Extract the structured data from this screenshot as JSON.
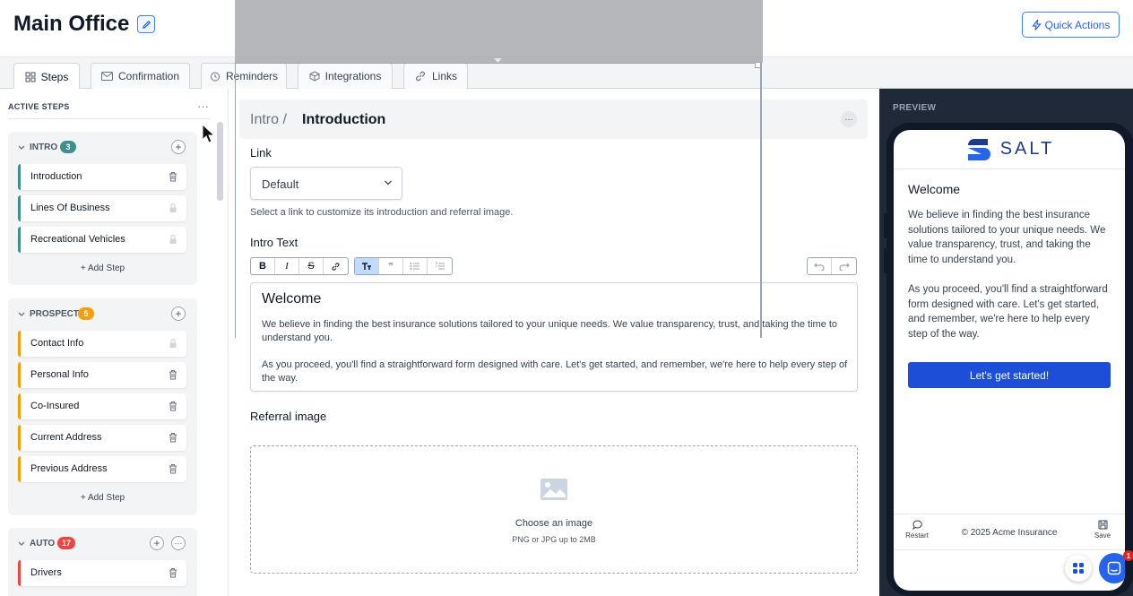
{
  "header": {
    "title": "Main Office",
    "quick_actions_label": "Quick Actions"
  },
  "tabs": [
    {
      "label": "Steps",
      "icon": "grid-icon",
      "active": true
    },
    {
      "label": "Confirmation",
      "icon": "mail-icon",
      "active": false
    },
    {
      "label": "Reminders",
      "icon": "alarm-clock-icon",
      "active": false
    },
    {
      "label": "Integrations",
      "icon": "cube-icon",
      "active": false
    },
    {
      "label": "Links",
      "icon": "link-icon",
      "active": false
    }
  ],
  "sidebar": {
    "heading": "ACTIVE STEPS",
    "more": "···",
    "groups": [
      {
        "name": "INTRO",
        "count": "3",
        "badge_color": "#3f8f8a",
        "bar_color": "#3f8f8a",
        "steps": [
          {
            "label": "Introduction",
            "icon": "trash-icon"
          },
          {
            "label": "Lines Of Business",
            "icon": "lock-icon"
          },
          {
            "label": "Recreational Vehicles",
            "icon": "lock-icon"
          }
        ],
        "add_label": "Add Step"
      },
      {
        "name": "PROSPECT",
        "count": "5",
        "badge_color": "#f59e0b",
        "bar_color": "#f59e0b",
        "steps": [
          {
            "label": "Contact Info",
            "icon": "lock-icon"
          },
          {
            "label": "Personal Info",
            "icon": "trash-icon"
          },
          {
            "label": "Co-Insured",
            "icon": "trash-icon"
          },
          {
            "label": "Current Address",
            "icon": "trash-icon"
          },
          {
            "label": "Previous Address",
            "icon": "trash-icon"
          }
        ],
        "add_label": "Add Step"
      },
      {
        "name": "AUTO",
        "count": "17",
        "badge_color": "#ef4444",
        "bar_color": "#ef4444",
        "steps": [
          {
            "label": "Drivers",
            "icon": "trash-icon"
          }
        ]
      }
    ]
  },
  "main": {
    "breadcrumb_parent": "Intro /",
    "breadcrumb_title": "Introduction",
    "link_label": "Link",
    "link_value": "Default",
    "link_hint": "Select a link to customize its introduction and referral image.",
    "intro_text_label": "Intro Text",
    "toolbar": {
      "bold": "B",
      "italic": "I",
      "strike": "S",
      "quote": "❞"
    },
    "editor": {
      "heading": "Welcome",
      "p1": "We believe in finding the best insurance solutions tailored to your unique needs. We value transparency, trust, and taking the time to understand you.",
      "p2": "As you proceed, you'll find a straightforward form designed with care. Let's get started, and remember, we're here to help every step of the way."
    },
    "referral_label": "Referral image",
    "dropzone_title": "Choose an image",
    "dropzone_sub": "PNG or JPG up to 2MB"
  },
  "preview": {
    "label": "PREVIEW",
    "brand": "SALT",
    "heading": "Welcome",
    "p1": "We believe in finding the best insurance solutions tailored to your unique needs. We value transparency, trust, and taking the time to understand you.",
    "p2": "As you proceed, you'll find a straightforward form designed with care. Let's get started, and remember, we're here to help every step of the way.",
    "cta": "Let's get started!",
    "restart": "Restart",
    "copyright": "© 2025 Acme Insurance",
    "save": "Save",
    "notification_count": "1"
  },
  "colors": {
    "accent": "#2563eb",
    "brand_dark": "#1e3a8a"
  }
}
